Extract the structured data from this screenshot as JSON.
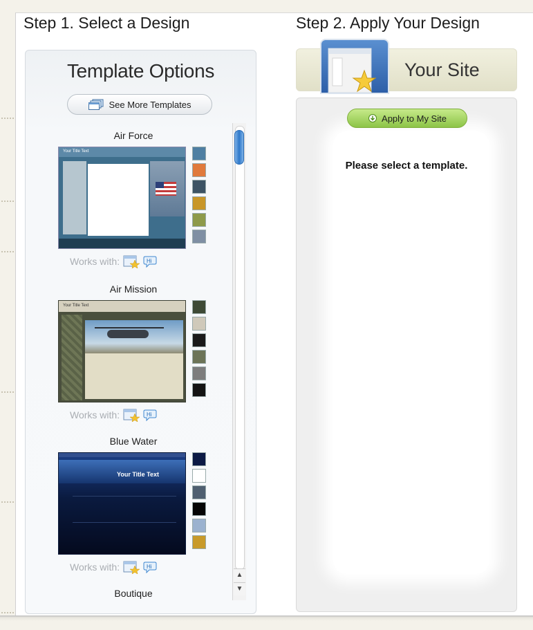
{
  "steps": {
    "step1_title": "Step 1. Select a Design",
    "step2_title": "Step 2. Apply Your Design"
  },
  "left_panel": {
    "title": "Template Options",
    "see_more_label": "See More Templates",
    "templates": [
      {
        "name": "Air Force",
        "thumb_title": "Your Title Text",
        "swatches": [
          "#4f7fa2",
          "#e07a3c",
          "#3d5364",
          "#c89628",
          "#8e9a4a",
          "#7f8fa3"
        ],
        "works_with_label": "Works with:"
      },
      {
        "name": "Air Mission",
        "thumb_title": "Your Title Text",
        "swatches": [
          "#3e4a36",
          "#cfc9ba",
          "#1a1a1a",
          "#6c7457",
          "#7d7d7d",
          "#141414"
        ],
        "works_with_label": "Works with:"
      },
      {
        "name": "Blue Water",
        "thumb_title": "Your Title Text",
        "swatches": [
          "#0c1a45",
          "#ffffff",
          "#4f5f70",
          "#050505",
          "#9bb2cf",
          "#c89a2a"
        ],
        "works_with_label": "Works with:"
      }
    ],
    "next_template_name": "Boutique"
  },
  "right_panel": {
    "site_label": "Your Site",
    "apply_label": "Apply to My Site",
    "message": "Please select a template."
  },
  "icons": {
    "see_more": "stacked-windows-icon",
    "apply": "refresh-arrow-icon",
    "works_site": "site-star-icon",
    "works_hi": "hi-chat-bubble-icon",
    "scroll_up": "arrow-up-icon",
    "scroll_down": "arrow-down-icon"
  }
}
